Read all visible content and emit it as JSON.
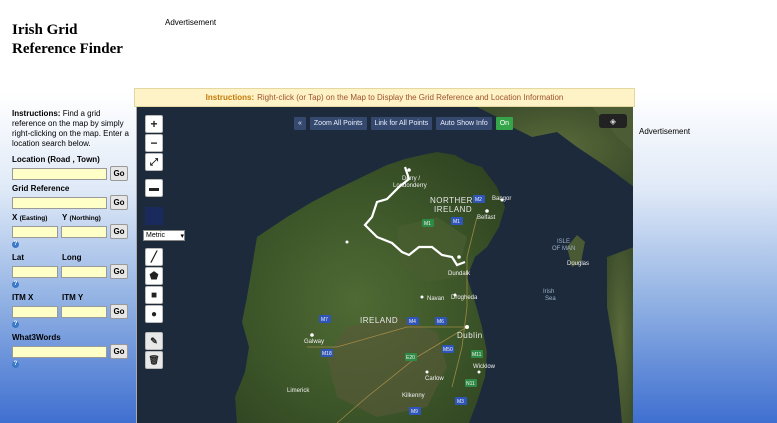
{
  "page": {
    "title": "Irish Grid Reference Finder",
    "ad_top": "Advertisement",
    "ad_right": "Advertisement"
  },
  "sidebar": {
    "instructions_label": "Instructions:",
    "instructions_text": "Find a grid reference on the map by simply right-clicking on the map. Enter a location search below.",
    "location_label": "Location (Road , Town)",
    "grid_ref_label": "Grid Reference",
    "x_label": "X",
    "x_sub": "(Easting)",
    "y_label": "Y",
    "y_sub": "(Northing)",
    "lat_label": "Lat",
    "long_label": "Long",
    "itm_x_label": "ITM X",
    "itm_y_label": "ITM Y",
    "what3words_label": "What3Words",
    "go_label": "Go",
    "help_glyph": "?"
  },
  "instructions_bar": {
    "label": "Instructions:",
    "text": "Right-click (or Tap) on the Map to Display the Grid Reference and Location Information"
  },
  "map": {
    "buttons": {
      "collapse": "«",
      "zoom_all": "Zoom All Points",
      "link_all": "Link for All Points",
      "auto_show": "Auto Show Info",
      "on": "On"
    },
    "units_selected": "Metric",
    "controls": [
      "zoom-in",
      "zoom-out",
      "fullscreen",
      "folder",
      "draw-line",
      "draw-polygon",
      "draw-rectangle",
      "draw-circle",
      "edit",
      "delete"
    ],
    "places": {
      "derry": "Derry /",
      "londonderry": "Londonderry",
      "northern_ireland_1": "NORTHERN",
      "northern_ireland_2": "IRELAND",
      "belfast": "Belfast",
      "bangor": "Bangor",
      "isle_of_man_1": "ISLE",
      "isle_of_man_2": "OF MAN",
      "dundalk": "Dundalk",
      "ireland": "IRELAND",
      "drogheda": "Drogheda",
      "navan": "Navan",
      "galway": "Galway",
      "dublin": "Dublin",
      "irish_sea_1": "Irish",
      "irish_sea_2": "Sea",
      "wicklow": "Wicklow",
      "carlow": "Carlow",
      "kilkenny": "Kilkenny",
      "limerick": "Limerick",
      "douglas": "Douglas"
    },
    "road_labels": [
      "M2",
      "M1",
      "M1",
      "M6",
      "M4",
      "M7",
      "M18",
      "M9",
      "M50",
      "M11",
      "E20",
      "N11",
      "M3"
    ],
    "colors": {
      "sea": "#1c2a3c",
      "land_green": "#3f5a2c",
      "land_brown": "#5b5a3a",
      "border": "#ffffff",
      "button_bg": "#374b73",
      "on_bg": "#36a54a"
    }
  }
}
